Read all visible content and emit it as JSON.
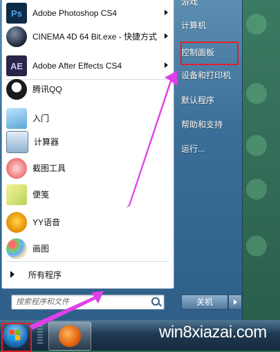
{
  "programs": [
    {
      "label": "Adobe Photoshop CS4",
      "icon": "photoshop-icon",
      "badge": "Ps",
      "arrow": true
    },
    {
      "label": "CINEMA 4D 64 Bit.exe - 快捷方式",
      "icon": "cinema4d-icon",
      "arrow": true
    },
    {
      "label": "Adobe After Effects CS4",
      "icon": "aftereffects-icon",
      "badge": "AE",
      "arrow": true
    },
    {
      "label": "腾讯QQ",
      "icon": "qq-penguin-icon",
      "arrow": false
    },
    {
      "label": "入门",
      "icon": "getting-started-icon",
      "arrow": false
    },
    {
      "label": "计算器",
      "icon": "calculator-icon",
      "arrow": false
    },
    {
      "label": "截图工具",
      "icon": "snipping-tool-icon",
      "arrow": false
    },
    {
      "label": "便笺",
      "icon": "sticky-notes-icon",
      "arrow": false
    },
    {
      "label": "YY语音",
      "icon": "yy-voice-icon",
      "arrow": false
    },
    {
      "label": "画图",
      "icon": "paint-icon",
      "arrow": false
    }
  ],
  "all_programs_label": "所有程序",
  "search": {
    "placeholder": "搜索程序和文件"
  },
  "right_links": [
    "游戏",
    "计算机",
    "控制面板",
    "设备和打印机",
    "默认程序",
    "帮助和支持",
    "运行..."
  ],
  "shutdown_label": "关机",
  "watermark": "win8xiazai.com",
  "colors": {
    "highlight": "#e0202a",
    "arrow": "#e040e8",
    "menu_blue": "#3b6f99"
  }
}
